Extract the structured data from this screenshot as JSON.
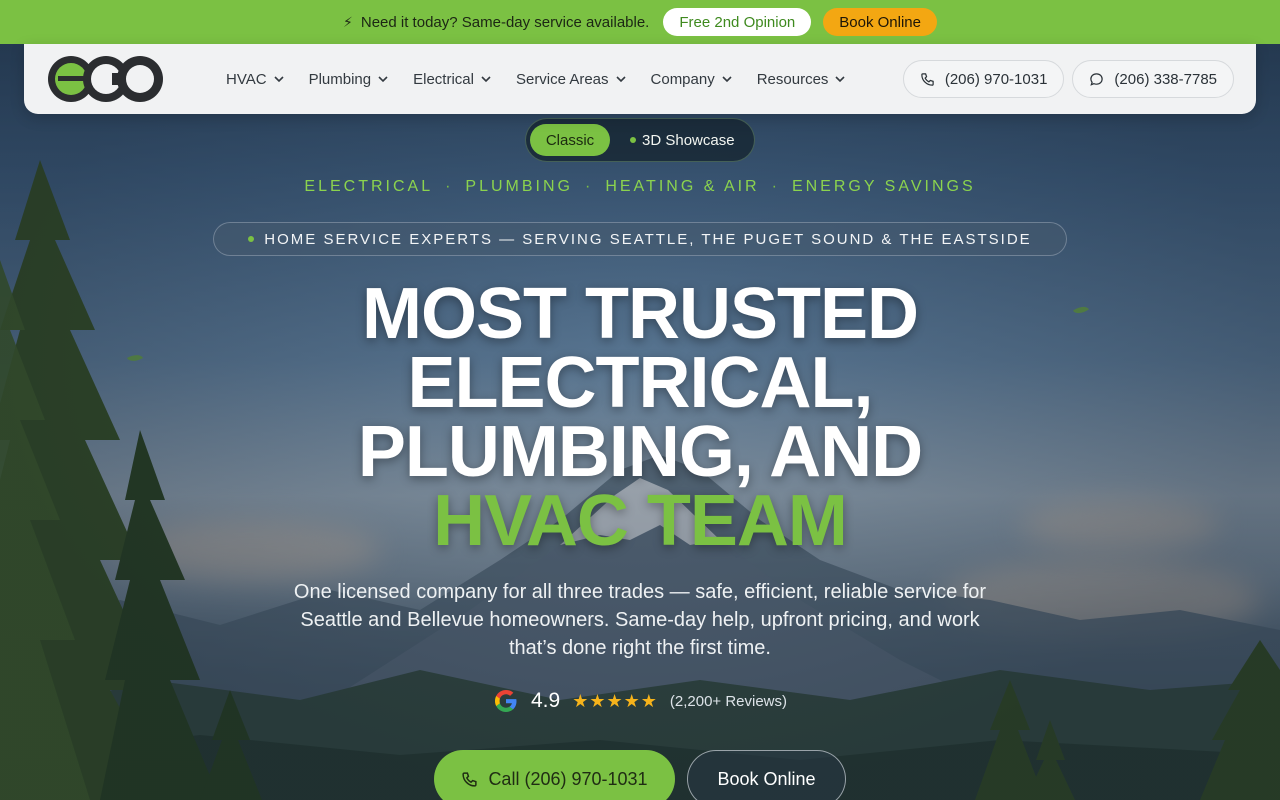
{
  "promo": {
    "icon": "lightning-icon",
    "message": "Need it today? Same-day service available.",
    "second_opinion_label": "Free 2nd Opinion",
    "book_label": "Book Online"
  },
  "header": {
    "logo_text": "eco",
    "nav": [
      {
        "label": "HVAC"
      },
      {
        "label": "Plumbing"
      },
      {
        "label": "Electrical"
      },
      {
        "label": "Service Areas"
      },
      {
        "label": "Company"
      },
      {
        "label": "Resources"
      }
    ],
    "phone_call": "(206) 970-1031",
    "phone_text": "(206) 338-7785"
  },
  "hero": {
    "toggle": {
      "classic": "Classic",
      "showcase": "3D Showcase",
      "selected": "Classic"
    },
    "trades": [
      "ELECTRICAL",
      "PLUMBING",
      "HEATING & AIR",
      "ENERGY SAVINGS"
    ],
    "trade_separator": "·",
    "experts_badge": "HOME SERVICE EXPERTS — SERVING SEATTLE, THE PUGET SOUND & THE EASTSIDE",
    "headline_line1": "MOST TRUSTED",
    "headline_line2": "ELECTRICAL,",
    "headline_line3": "PLUMBING, AND",
    "headline_accent": "HVAC TEAM",
    "subtext": "One licensed company for all three trades — safe, efficient, reliable service for Seattle and Bellevue homeowners. Same-day help, upfront pricing, and work that’s done right the first time.",
    "rating": {
      "score": "4.9",
      "stars": "★★★★★",
      "star_count": 5,
      "reviews": "(2,200+ Reviews)"
    },
    "cta_call": "Call (206) 970-1031",
    "cta_book": "Book Online"
  },
  "colors": {
    "brand_green": "#7bc143",
    "accent_orange": "#f3a712",
    "header_bg": "#f1f2f3",
    "star_gold": "#f6b31b"
  }
}
